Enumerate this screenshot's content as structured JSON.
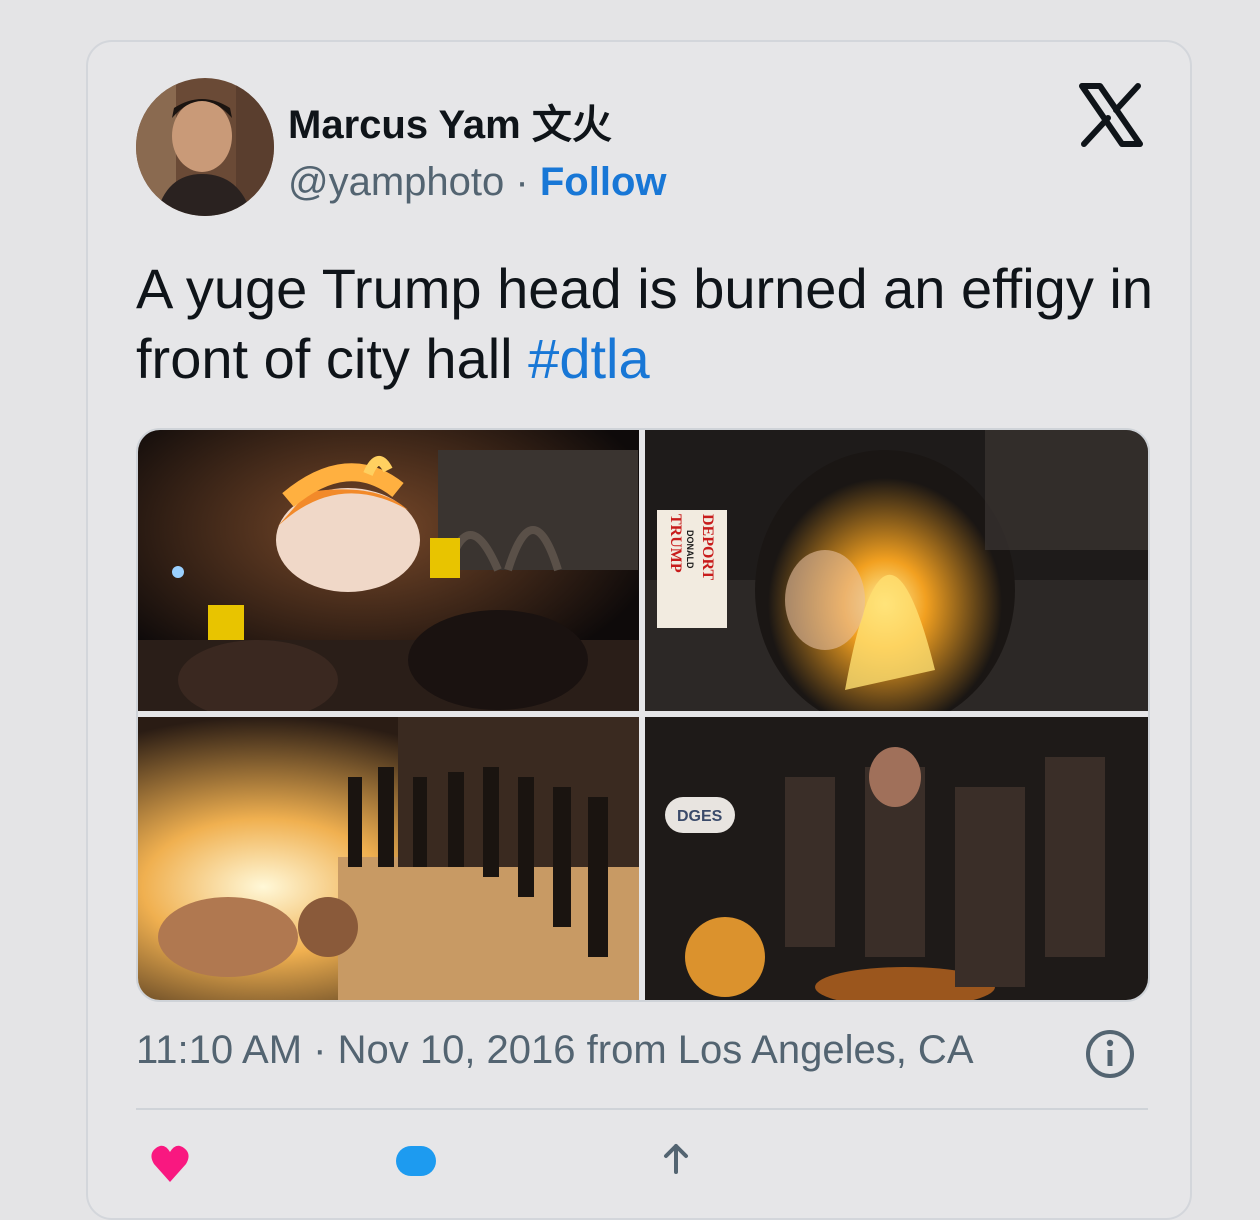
{
  "tweet": {
    "author_name": "Marcus Yam 文火",
    "handle": "@yamphoto",
    "separator": "·",
    "follow_label": "Follow",
    "text": "A yuge Trump head is burned an effigy in front of city hall ",
    "hashtag": "#dtla",
    "timestamp": "11:10 AM · Nov 10, 2016 from Los Angeles, CA",
    "photo_sign_text": [
      "DEPORT",
      "DONALD",
      "TRUMP"
    ],
    "photo_board_text": "DGES"
  },
  "icons": {
    "brand": "x-logo-icon",
    "info": "info-icon",
    "like": "heart-icon",
    "reply": "reply-icon",
    "share": "share-icon"
  },
  "colors": {
    "link": "#1877d6",
    "text": "#0f1419",
    "secondary": "#536471",
    "background": "#e6e6e8",
    "like": "#f91880"
  }
}
